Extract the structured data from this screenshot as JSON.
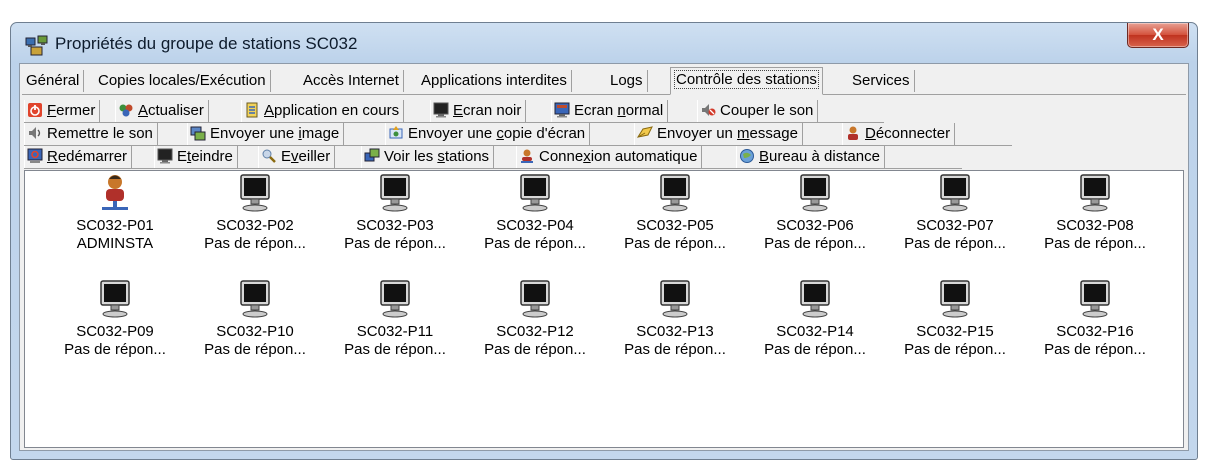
{
  "window": {
    "title": "Propriétés du groupe de stations SC032",
    "close_label": "X"
  },
  "tabs": [
    {
      "label": "Général"
    },
    {
      "label": "Copies locales/Exécution"
    },
    {
      "label": "Accès Internet"
    },
    {
      "label": "Applications interdites"
    },
    {
      "label": "Logs"
    },
    {
      "label": "Contrôle des stations",
      "active": true
    },
    {
      "label": "Services"
    }
  ],
  "toolbar": {
    "row1": [
      {
        "pre": "",
        "u": "F",
        "post": "ermer",
        "icon": "power-icon"
      },
      {
        "pre": "",
        "u": "A",
        "post": "ctualiser",
        "icon": "refresh-icon"
      },
      {
        "pre": "",
        "u": "A",
        "post": "pplication en cours",
        "icon": "application-icon"
      },
      {
        "pre": "",
        "u": "E",
        "post": "cran noir",
        "icon": "black-screen-icon"
      },
      {
        "pre": "Ecran ",
        "u": "n",
        "post": "ormal",
        "icon": "normal-screen-icon"
      },
      {
        "pre": "Couper le son",
        "u": "",
        "post": "",
        "icon": "mute-icon"
      }
    ],
    "row2": [
      {
        "pre": "Remettre le son",
        "u": "",
        "post": "",
        "icon": "sound-icon"
      },
      {
        "pre": "Envoyer une ",
        "u": "i",
        "post": "mage",
        "icon": "send-image-icon"
      },
      {
        "pre": "Envoyer une ",
        "u": "c",
        "post": "opie d'écran",
        "icon": "screenshot-icon"
      },
      {
        "pre": "Envoyer un ",
        "u": "m",
        "post": "essage",
        "icon": "message-icon"
      },
      {
        "pre": "",
        "u": "D",
        "post": "éconnecter",
        "icon": "disconnect-icon"
      }
    ],
    "row3": [
      {
        "pre": "",
        "u": "R",
        "post": "edémarrer",
        "icon": "restart-icon"
      },
      {
        "pre": "E",
        "u": "t",
        "post": "eindre",
        "icon": "shutdown-icon"
      },
      {
        "pre": "E",
        "u": "v",
        "post": "eiller",
        "icon": "wake-icon"
      },
      {
        "pre": "Voir les ",
        "u": "s",
        "post": "tations",
        "icon": "view-stations-icon"
      },
      {
        "pre": "Conne",
        "u": "x",
        "post": "ion automatique",
        "icon": "auto-login-icon"
      },
      {
        "pre": "",
        "u": "B",
        "post": "ureau à distance",
        "icon": "remote-desktop-icon"
      }
    ]
  },
  "stations": [
    {
      "name": "SC032-P01",
      "status": "ADMINSTA",
      "icon": "user-station-icon"
    },
    {
      "name": "SC032-P02",
      "status": "Pas de répon...",
      "icon": "monitor-icon"
    },
    {
      "name": "SC032-P03",
      "status": "Pas de répon...",
      "icon": "monitor-icon"
    },
    {
      "name": "SC032-P04",
      "status": "Pas de répon...",
      "icon": "monitor-icon"
    },
    {
      "name": "SC032-P05",
      "status": "Pas de répon...",
      "icon": "monitor-icon"
    },
    {
      "name": "SC032-P06",
      "status": "Pas de répon...",
      "icon": "monitor-icon"
    },
    {
      "name": "SC032-P07",
      "status": "Pas de répon...",
      "icon": "monitor-icon"
    },
    {
      "name": "SC032-P08",
      "status": "Pas de répon...",
      "icon": "monitor-icon"
    },
    {
      "name": "SC032-P09",
      "status": "Pas de répon...",
      "icon": "monitor-icon"
    },
    {
      "name": "SC032-P10",
      "status": "Pas de répon...",
      "icon": "monitor-icon"
    },
    {
      "name": "SC032-P11",
      "status": "Pas de répon...",
      "icon": "monitor-icon"
    },
    {
      "name": "SC032-P12",
      "status": "Pas de répon...",
      "icon": "monitor-icon"
    },
    {
      "name": "SC032-P13",
      "status": "Pas de répon...",
      "icon": "monitor-icon"
    },
    {
      "name": "SC032-P14",
      "status": "Pas de répon...",
      "icon": "monitor-icon"
    },
    {
      "name": "SC032-P15",
      "status": "Pas de répon...",
      "icon": "monitor-icon"
    },
    {
      "name": "SC032-P16",
      "status": "Pas de répon...",
      "icon": "monitor-icon"
    }
  ]
}
